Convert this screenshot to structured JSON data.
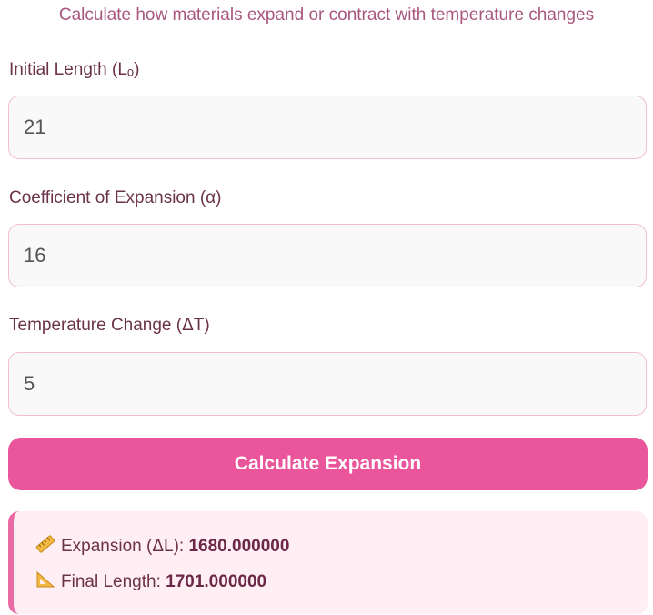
{
  "subtitle": "Calculate how materials expand or contract with temperature changes",
  "fields": [
    {
      "label": "Initial Length (Lₒ)",
      "value": "21"
    },
    {
      "label": "Coefficient of Expansion (α)",
      "value": "16"
    },
    {
      "label": "Temperature Change (ΔT)",
      "value": "5"
    }
  ],
  "calculate_button": "Calculate Expansion",
  "results": {
    "expansion_label": "Expansion (ΔL): ",
    "expansion_value": "1680.000000",
    "expansion_icon": "ruler-icon",
    "final_label": "Final Length: ",
    "final_value": "1701.000000",
    "final_icon": "triangular-ruler-icon"
  },
  "colors": {
    "accent": "#ea559b",
    "result_bg": "#ffeef3",
    "text": "#6b3349"
  }
}
